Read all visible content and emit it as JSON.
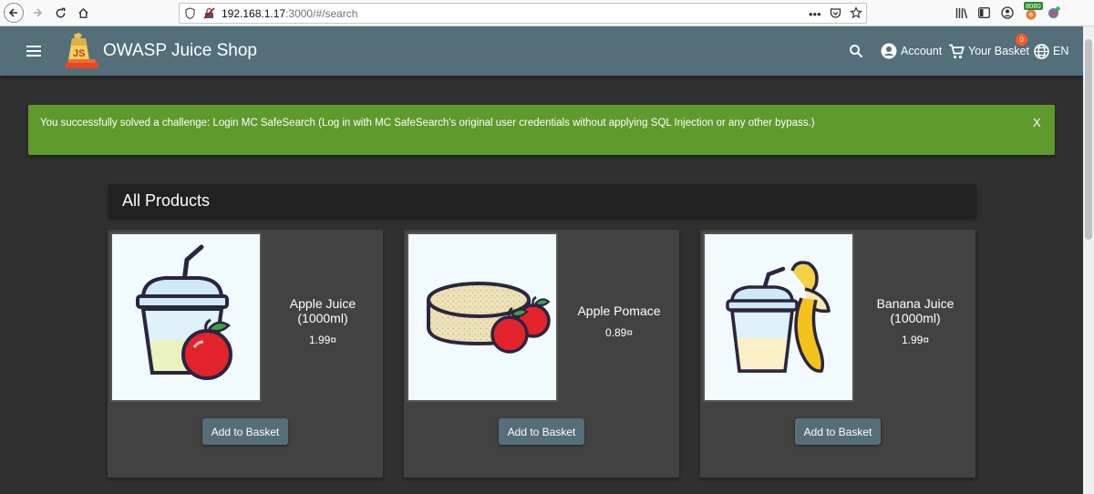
{
  "browser": {
    "url_host": "192.168.1.17",
    "url_path": ":3000/#/search",
    "ext_badge": "8080"
  },
  "app": {
    "title": "OWASP Juice Shop",
    "logo_text": "JS",
    "account_label": "Account",
    "basket_label": "Your Basket",
    "basket_count": "0",
    "language": "EN"
  },
  "banner": {
    "message": "You successfully solved a challenge: Login MC SafeSearch (Log in with MC SafeSearch's original user credentials without applying SQL Injection or any other bypass.)",
    "close": "X"
  },
  "products": {
    "title": "All Products",
    "items": [
      {
        "name": "Apple Juice (1000ml)",
        "price": "1.99¤",
        "button": "Add to Basket",
        "image": "apple-juice-image"
      },
      {
        "name": "Apple Pomace",
        "price": "0.89¤",
        "button": "Add to Basket",
        "image": "apple-pomace-image"
      },
      {
        "name": "Banana Juice (1000ml)",
        "price": "1.99¤",
        "button": "Add to Basket",
        "image": "banana-juice-image"
      }
    ]
  },
  "colors": {
    "toolbar": "#546e7a",
    "background": "#303030",
    "banner": "#5f9a2c",
    "card": "#424242",
    "badge": "#ff5722"
  }
}
